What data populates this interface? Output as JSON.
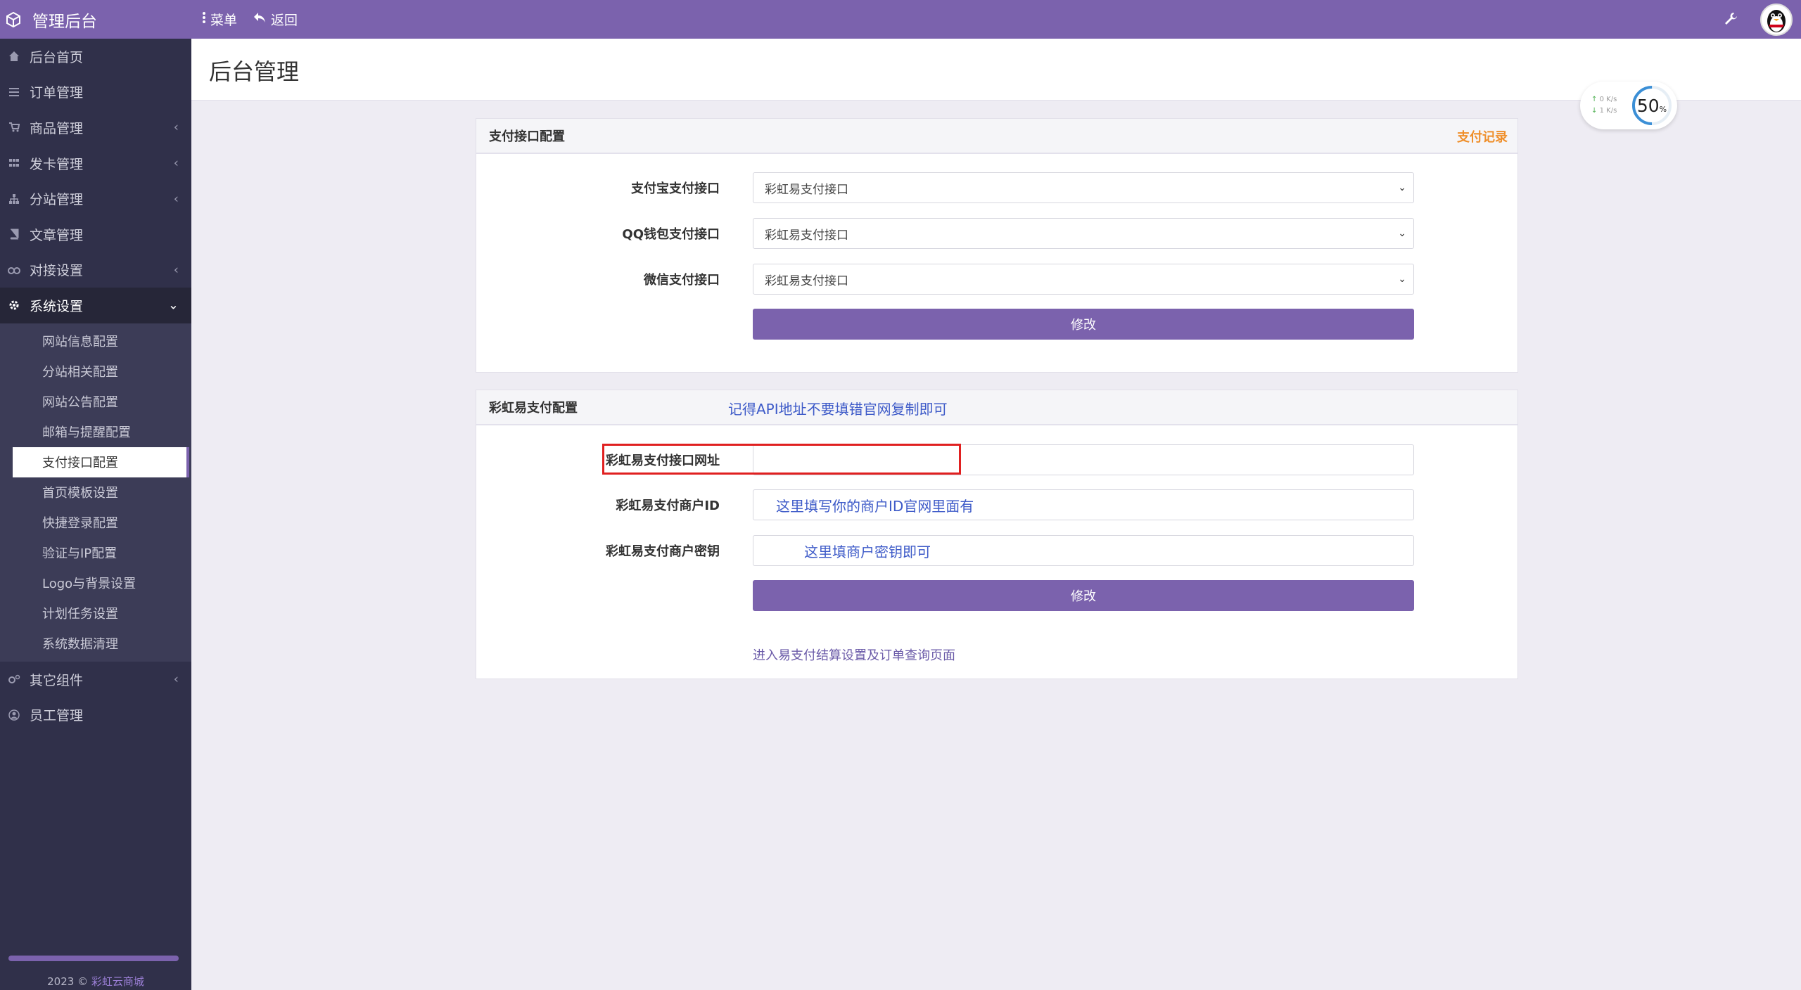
{
  "app": {
    "title": "管理后台"
  },
  "topbar": {
    "menu_label": "菜单",
    "back_label": "返回",
    "settings_icon": "wrench-icon",
    "avatar_icon": "penguin-avatar"
  },
  "sidebar": {
    "items": [
      {
        "label": "后台首页",
        "icon": "home-icon"
      },
      {
        "label": "订单管理",
        "icon": "list-icon"
      },
      {
        "label": "商品管理",
        "icon": "cart-icon"
      },
      {
        "label": "发卡管理",
        "icon": "grid-icon"
      },
      {
        "label": "分站管理",
        "icon": "sitemap-icon"
      },
      {
        "label": "文章管理",
        "icon": "book-icon"
      },
      {
        "label": "对接设置",
        "icon": "link-icon"
      },
      {
        "label": "系统设置",
        "icon": "gear-icon"
      }
    ],
    "submenu": [
      "网站信息配置",
      "分站相关配置",
      "网站公告配置",
      "邮箱与提醒配置",
      "支付接口配置",
      "首页模板设置",
      "快捷登录配置",
      "验证与IP配置",
      "Logo与背景设置",
      "计划任务设置",
      "系统数据清理"
    ],
    "active_sub": "支付接口配置",
    "bottom_items": [
      {
        "label": "其它组件",
        "icon": "cogs-icon"
      },
      {
        "label": "员工管理",
        "icon": "user-icon"
      }
    ],
    "footer_year": "2023 ©",
    "footer_link": "彩虹云商城"
  },
  "page": {
    "title": "后台管理"
  },
  "netwidget": {
    "up_rate": "0",
    "down_rate": "1",
    "unit": "K/s",
    "percent": "50",
    "percent_unit": "%",
    "ring_level": 0.5
  },
  "panel1": {
    "title": "支付接口配置",
    "right_link": "支付记录",
    "fields": [
      {
        "label": "支付宝支付接口",
        "value": "彩虹易支付接口"
      },
      {
        "label": "QQ钱包支付接口",
        "value": "彩虹易支付接口"
      },
      {
        "label": "微信支付接口",
        "value": "彩虹易支付接口"
      }
    ],
    "submit_label": "修改"
  },
  "panel2": {
    "title": "彩虹易支付配置",
    "note": "记得API地址不要填错官网复制即可",
    "fields": [
      {
        "label": "彩虹易支付接口网址",
        "value": ""
      },
      {
        "label": "彩虹易支付商户ID",
        "value": "这里填写你的商户ID官网里面有"
      },
      {
        "label": "彩虹易支付商户密钥",
        "value": "这里填商户密钥即可"
      }
    ],
    "submit_label": "修改",
    "bottom_link": "进入易支付结算设置及订单查询页面"
  },
  "colors": {
    "primary": "#7b62ad",
    "sidebar": "#30304a",
    "accent_orange": "#ef8f2b",
    "hint_blue": "#3d5ac8",
    "highlight_red": "#e02020"
  }
}
